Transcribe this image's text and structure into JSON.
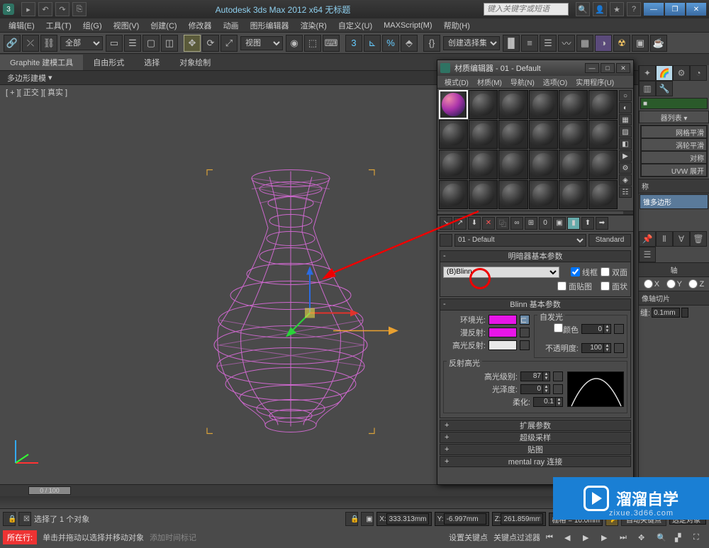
{
  "title": "Autodesk 3ds Max  2012 x64   无标题",
  "search_placeholder": "键入关键字或短语",
  "menus": [
    "编辑(E)",
    "工具(T)",
    "组(G)",
    "视图(V)",
    "创建(C)",
    "修改器",
    "动画",
    "图形编辑器",
    "渲染(R)",
    "自定义(U)",
    "MAXScript(M)",
    "帮助(H)"
  ],
  "toolbar_dropdown_all": "全部",
  "toolbar_dropdown_view": "视图",
  "toolbar_dropdown_select": "创建选择集",
  "ribbon": {
    "main": "Graphite 建模工具",
    "tabs": [
      "自由形式",
      "选择",
      "对象绘制"
    ]
  },
  "sublabel": "多边形建模",
  "viewport_label": "[ + ][ 正交 ][ 真实 ]",
  "mateditor": {
    "title": "材质编辑器 - 01 - Default",
    "menus": [
      "模式(D)",
      "材质(M)",
      "导航(N)",
      "选项(O)",
      "实用程序(U)"
    ],
    "material_name": "01 - Default",
    "type_button": "Standard",
    "rollouts": {
      "shader_title": "明暗器基本参数",
      "shader": "(B)Blinn",
      "wire": "线框",
      "twoside": "双面",
      "facemap": "面贴图",
      "faceted": "面状",
      "blinn_title": "Blinn 基本参数",
      "ambient": "环境光:",
      "diffuse": "漫反射:",
      "specular": "高光反射:",
      "selfillum_group": "自发光",
      "selfillum_color": "颜色",
      "selfillum_val": "0",
      "opacity": "不透明度:",
      "opacity_val": "100",
      "spec_group": "反射高光",
      "spec_level": "高光级别:",
      "spec_level_val": "87",
      "gloss": "光泽度:",
      "gloss_val": "0",
      "soften": "柔化:",
      "soften_val": "0.1",
      "collapsed": [
        "扩展参数",
        "超级采样",
        "贴图",
        "mental ray 连接"
      ]
    }
  },
  "cmdpanel": {
    "mods": [
      "网格平滑",
      "涡轮平滑",
      "对称",
      "UVW 展开"
    ],
    "stack_header": "称",
    "stack_item": "锥多边形",
    "axis_group": "轴",
    "axes": [
      "X",
      "Y",
      "Z"
    ],
    "section": "像轴切片",
    "slice_label": "缝:",
    "slice_val": "0.1mm"
  },
  "bottom": {
    "slider": "0 / 100",
    "selected": "选择了 1 个对象",
    "x": "333.313mm",
    "y": "-6.997mm",
    "z": "261.859mm",
    "grid": "栅格 = 10.0mm",
    "autokey": "自动关键点",
    "selset": "选定对象",
    "now": "所在行:",
    "hint1": "单击并拖动以选择并移动对象",
    "hint2": "添加时间标记",
    "setkey": "设置关键点",
    "keyfilter": "关键点过滤器"
  },
  "watermark": {
    "brand": "溜溜自学",
    "url": "zixue.3d66.com"
  }
}
